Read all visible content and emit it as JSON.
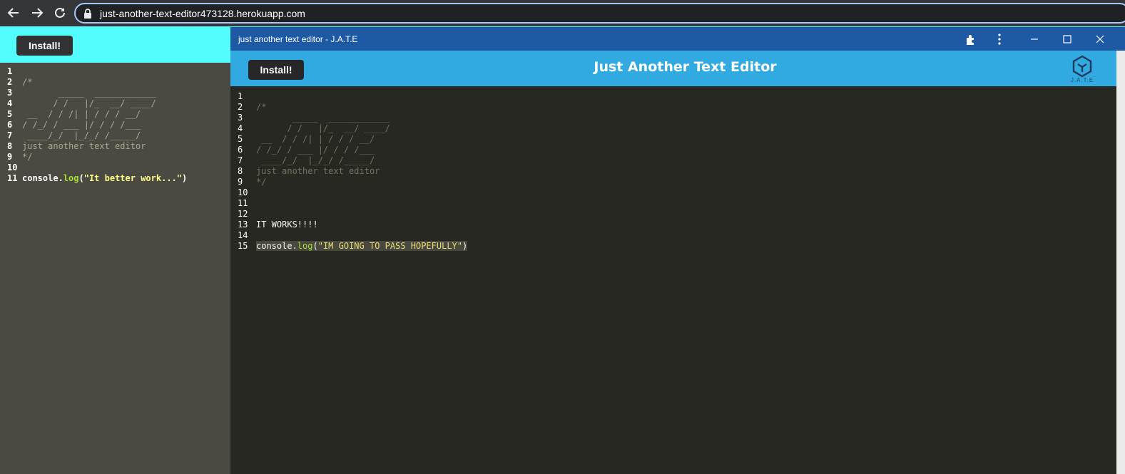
{
  "browser": {
    "url": "just-another-text-editor473128.herokuapp.com"
  },
  "background_page": {
    "install_label": "Install!",
    "lines": [
      {
        "n": "1",
        "t": ""
      },
      {
        "n": "2",
        "t": "/*"
      },
      {
        "n": "3",
        "t": "       _____  ____________"
      },
      {
        "n": "4",
        "t": "      / /   |/_  __/ ____/"
      },
      {
        "n": "5",
        "t": " __  / / /| | / / / __/"
      },
      {
        "n": "6",
        "t": "/ /_/ / ___ |/ / / /___"
      },
      {
        "n": "7",
        "t": " ____/_/  |_/_/ /_____/"
      },
      {
        "n": "8",
        "t": "just another text editor"
      },
      {
        "n": "9",
        "t": "*/"
      },
      {
        "n": "10",
        "t": ""
      }
    ],
    "code_line": {
      "n": "11",
      "obj": "console.",
      "fn": "log",
      "open": "(",
      "str": "\"It better work...\"",
      "close": ")"
    }
  },
  "app_window": {
    "title": "just another text editor - J.A.T.E",
    "install_label": "Install!",
    "heading": "Just Another Text Editor",
    "logo_text": "J.A.T.E",
    "lines": [
      {
        "n": "1",
        "t": ""
      },
      {
        "n": "2",
        "t": "/*"
      },
      {
        "n": "3",
        "t": "       _____  ____________"
      },
      {
        "n": "4",
        "t": "      / /   |/_  __/ ____/"
      },
      {
        "n": "5",
        "t": " __  / / /| | / / / __/"
      },
      {
        "n": "6",
        "t": "/ /_/ / ___ |/ / / /___"
      },
      {
        "n": "7",
        "t": " ____/_/  |_/_/ /_____/"
      },
      {
        "n": "8",
        "t": "just another text editor"
      },
      {
        "n": "9",
        "t": "*/"
      },
      {
        "n": "10",
        "t": ""
      },
      {
        "n": "11",
        "t": ""
      },
      {
        "n": "12",
        "t": ""
      },
      {
        "n": "13",
        "t": "IT WORKS!!!!"
      },
      {
        "n": "14",
        "t": ""
      }
    ],
    "code_line": {
      "n": "15",
      "obj": "console.",
      "fn": "log",
      "open": "(",
      "str": "\"IM GOING TO PASS HOPEFULLY\"",
      "close": ")"
    }
  },
  "colors": {
    "bg_header": "#53fdfd",
    "window_title_bar": "#1e5aa3",
    "window_header": "#31a9e1",
    "editor_bg": "#272822"
  },
  "icons": [
    "back-arrow-icon",
    "forward-arrow-icon",
    "reload-icon",
    "lock-icon",
    "extensions-puzzle-icon",
    "more-vert-icon",
    "minimize-icon",
    "maximize-icon",
    "close-icon",
    "jate-logo-icon"
  ]
}
